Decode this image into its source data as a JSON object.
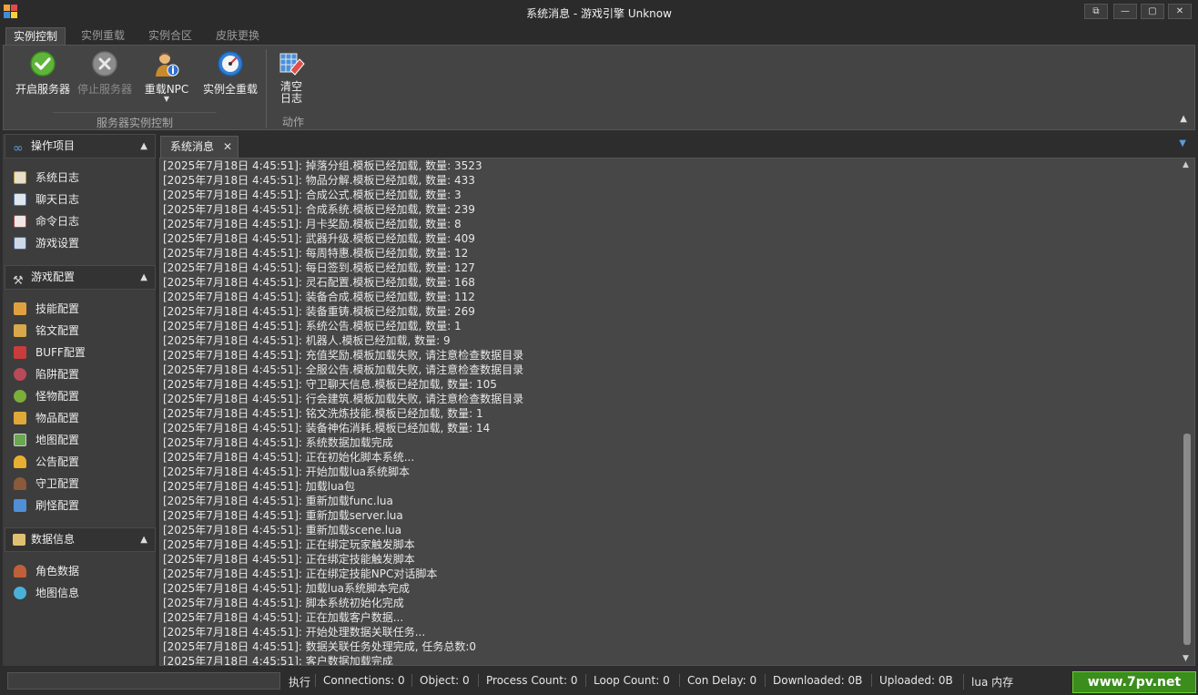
{
  "window": {
    "title": "系统消息 - 游戏引擎  Unknow",
    "controls": [
      "restore-icon",
      "minimize-icon",
      "maximize-icon",
      "close-icon"
    ]
  },
  "ribbon_tabs": [
    "实例控制",
    "实例重载",
    "实例合区",
    "皮肤更换"
  ],
  "ribbon": {
    "server_group_label": "服务器实例控制",
    "action_group_label": "动作",
    "buttons": {
      "start": "开启服务器",
      "stop": "停止服务器",
      "reload_npc": "重载NPC",
      "reload_all": "实例全重载",
      "clear_log": "清空\n日志"
    }
  },
  "nav": {
    "sections": [
      {
        "title": "操作项目",
        "items": [
          "系统日志",
          "聊天日志",
          "命令日志",
          "游戏设置"
        ]
      },
      {
        "title": "游戏配置",
        "items": [
          "技能配置",
          "铭文配置",
          "BUFF配置",
          "陷阱配置",
          "怪物配置",
          "物品配置",
          "地图配置",
          "公告配置",
          "守卫配置",
          "刷怪配置"
        ]
      },
      {
        "title": "数据信息",
        "items": [
          "角色数据",
          "地图信息"
        ]
      }
    ]
  },
  "document": {
    "tab_label": "系统消息",
    "close_glyph": "✕"
  },
  "log_lines": [
    "[2025年7月18日 4:45:51]: 掉落分组.模板已经加载,  数量: 3523",
    "[2025年7月18日 4:45:51]: 物品分解.模板已经加载,  数量: 433",
    "[2025年7月18日 4:45:51]: 合成公式.模板已经加载,  数量: 3",
    "[2025年7月18日 4:45:51]: 合成系统.模板已经加载,  数量: 239",
    "[2025年7月18日 4:45:51]: 月卡奖励.模板已经加载,  数量: 8",
    "[2025年7月18日 4:45:51]: 武器升级.模板已经加载,  数量: 409",
    "[2025年7月18日 4:45:51]: 每周特惠.模板已经加载,  数量: 12",
    "[2025年7月18日 4:45:51]: 每日签到.模板已经加载,  数量: 127",
    "[2025年7月18日 4:45:51]: 灵石配置.模板已经加载,  数量: 168",
    "[2025年7月18日 4:45:51]: 装备合成.模板已经加载,  数量: 112",
    "[2025年7月18日 4:45:51]: 装备重铸.模板已经加载,  数量: 269",
    "[2025年7月18日 4:45:51]: 系统公告.模板已经加载,  数量: 1",
    "[2025年7月18日 4:45:51]: 机器人.模板已经加载,  数量: 9",
    "[2025年7月18日 4:45:51]: 充值奖励.模板加载失败, 请注意检查数据目录",
    "[2025年7月18日 4:45:51]: 全服公告.模板加载失败, 请注意检查数据目录",
    "[2025年7月18日 4:45:51]: 守卫聊天信息.模板已经加载,  数量: 105",
    "[2025年7月18日 4:45:51]: 行会建筑.模板加载失败, 请注意检查数据目录",
    "[2025年7月18日 4:45:51]: 铭文洗炼技能.模板已经加载,  数量: 1",
    "[2025年7月18日 4:45:51]: 装备神佑消耗.模板已经加载,  数量: 14",
    "[2025年7月18日 4:45:51]: 系统数据加载完成",
    "[2025年7月18日 4:45:51]: 正在初始化脚本系统...",
    "[2025年7月18日 4:45:51]: 开始加载lua系统脚本",
    "[2025年7月18日 4:45:51]: 加载lua包",
    "[2025年7月18日 4:45:51]: 重新加载func.lua",
    "[2025年7月18日 4:45:51]: 重新加载server.lua",
    "[2025年7月18日 4:45:51]: 重新加载scene.lua",
    "[2025年7月18日 4:45:51]: 正在绑定玩家触发脚本",
    "[2025年7月18日 4:45:51]: 正在绑定技能触发脚本",
    "[2025年7月18日 4:45:51]: 正在绑定技能NPC对话脚本",
    "[2025年7月18日 4:45:51]: 加载lua系统脚本完成",
    "[2025年7月18日 4:45:51]: 脚本系统初始化完成",
    "[2025年7月18日 4:45:51]: 正在加载客户数据...",
    "[2025年7月18日 4:45:51]: 开始处理数据关联任务...",
    "[2025年7月18日 4:45:51]: 数据关联任务处理完成, 任务总数:0",
    "[2025年7月18日 4:45:51]: 客户数据加载完成"
  ],
  "statusbar": {
    "execute": "执行",
    "connections": "Connections: 0",
    "object": "Object: 0",
    "process_count": "Process Count: 0",
    "loop_count": "Loop Count: 0",
    "con_delay": "Con Delay: 0",
    "downloaded": "Downloaded: 0B",
    "uploaded": "Uploaded: 0B",
    "lua_memory": "lua 内存",
    "watermark": "www.7pv.net"
  },
  "colors": {
    "accent_blue": "#5b9bd5",
    "watermark_green": "#3b8d1c",
    "start_green": "#5fb53a"
  }
}
